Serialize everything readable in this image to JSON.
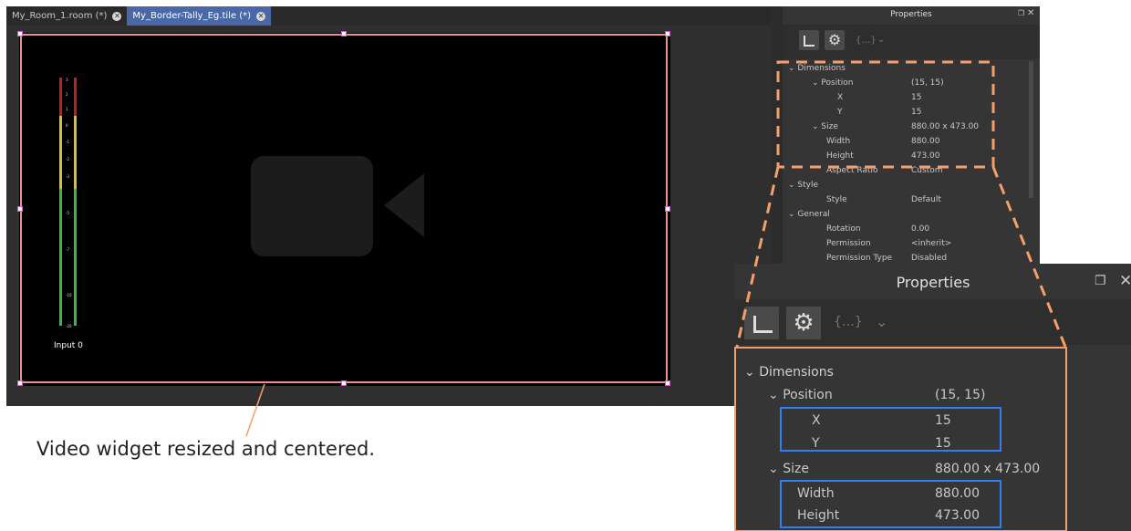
{
  "tabs": [
    {
      "label": "My_Room_1.room (*)"
    },
    {
      "label": "My_Border-Tally_Eg.tile (*)"
    }
  ],
  "canvas": {
    "meter_ticks": [
      "3",
      "2",
      "1",
      "0",
      "-1",
      "-2",
      "-3",
      "-5",
      "-7",
      "-10",
      "-20"
    ],
    "meter_label": "Input 0"
  },
  "properties_small": {
    "title": "Properties",
    "dimensions": "Dimensions",
    "position": {
      "label": "Position",
      "value": "(15, 15)"
    },
    "x": {
      "label": "X",
      "value": "15"
    },
    "y": {
      "label": "Y",
      "value": "15"
    },
    "size": {
      "label": "Size",
      "value": "880.00 x 473.00"
    },
    "width": {
      "label": "Width",
      "value": "880.00"
    },
    "height": {
      "label": "Height",
      "value": "473.00"
    },
    "aspect_ratio": {
      "label": "Aspect Ratio",
      "value": "Custom"
    },
    "style_group": "Style",
    "style": {
      "label": "Style",
      "value": "Default"
    },
    "general": "General",
    "rotation": {
      "label": "Rotation",
      "value": "0.00"
    },
    "permission": {
      "label": "Permission",
      "value": "<inherit>"
    },
    "permission_type": {
      "label": "Permission Type",
      "value": "Disabled"
    }
  },
  "properties_large": {
    "title": "Properties",
    "dimensions": "Dimensions",
    "position": {
      "label": "Position",
      "value": "(15, 15)"
    },
    "x": {
      "label": "X",
      "value": "15"
    },
    "y": {
      "label": "Y",
      "value": "15"
    },
    "size": {
      "label": "Size",
      "value": "880.00 x 473.00"
    },
    "width": {
      "label": "Width",
      "value": "880.00"
    },
    "height": {
      "label": "Height",
      "value": "473.00"
    }
  },
  "annotation": "Video widget resized and centered.",
  "colors": {
    "accent": "#4a67a8",
    "selection": "#f08f8f",
    "callout": "#f5a06a",
    "highlight": "#2d7ef7"
  }
}
